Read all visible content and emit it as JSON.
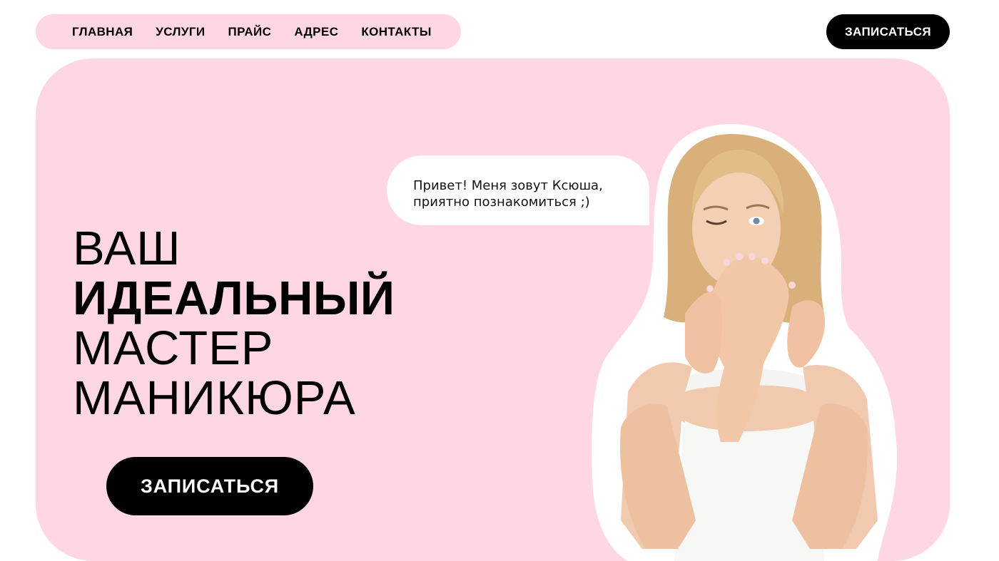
{
  "nav": {
    "items": [
      {
        "label": "ГЛАВНАЯ"
      },
      {
        "label": "УСЛУГИ"
      },
      {
        "label": "ПРАЙС"
      },
      {
        "label": "АДРЕС"
      },
      {
        "label": "КОНТАКТЫ"
      }
    ],
    "cta_label": "ЗАПИСАТЬСЯ"
  },
  "hero": {
    "headline": {
      "line1": "ВАШ",
      "line2": "ИДЕАЛЬНЫЙ",
      "line3": "МАСТЕР",
      "line4": "МАНИКЮРА"
    },
    "cta_label": "ЗАПИСАТЬСЯ",
    "bubble": {
      "line1": "Привет! Меня зовут Ксюша,",
      "line2": "приятно познакомиться ;)"
    },
    "photo_icon": "woman-portrait-photo"
  },
  "colors": {
    "pink": "#fed7e2",
    "black": "#000000",
    "white": "#ffffff"
  }
}
